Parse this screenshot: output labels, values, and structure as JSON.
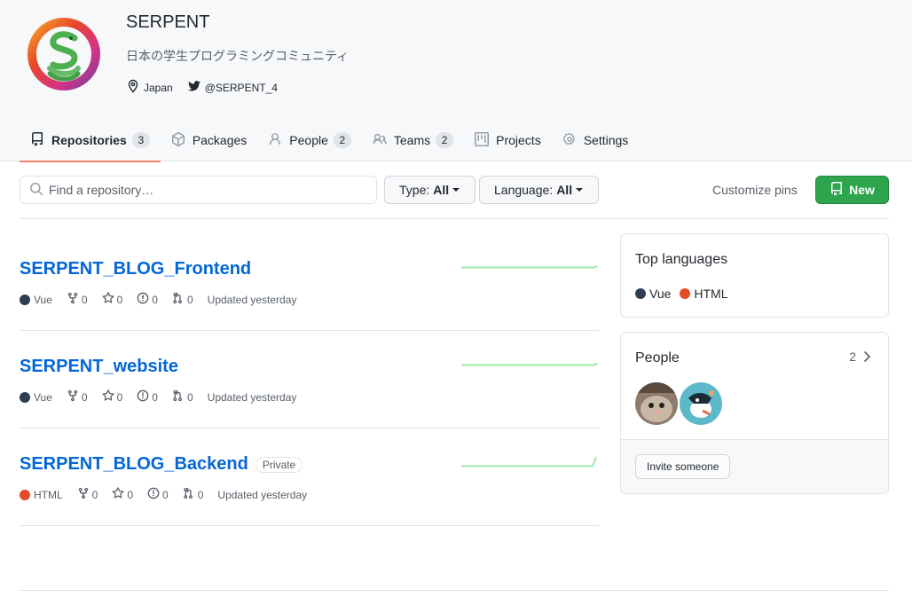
{
  "org": {
    "name": "SERPENT",
    "description": "日本の学生プログラミングコミュニティ",
    "location": "Japan",
    "twitter": "@SERPENT_4"
  },
  "tabs": [
    {
      "label": "Repositories",
      "count": "3",
      "active": true
    },
    {
      "label": "Packages"
    },
    {
      "label": "People",
      "count": "2"
    },
    {
      "label": "Teams",
      "count": "2"
    },
    {
      "label": "Projects"
    },
    {
      "label": "Settings"
    }
  ],
  "toolbar": {
    "search_placeholder": "Find a repository…",
    "type_label": "Type:",
    "type_value": "All",
    "language_label": "Language:",
    "language_value": "All",
    "customize_pins": "Customize pins",
    "new_label": "New"
  },
  "repos": [
    {
      "name": "SERPENT_BLOG_Frontend",
      "language": "Vue",
      "language_color": "#2c3e50",
      "forks": "0",
      "stars": "0",
      "issues": "0",
      "pulls": "0",
      "updated": "Updated yesterday"
    },
    {
      "name": "SERPENT_website",
      "language": "Vue",
      "language_color": "#2c3e50",
      "forks": "0",
      "stars": "0",
      "issues": "0",
      "pulls": "0",
      "updated": "Updated yesterday"
    },
    {
      "name": "SERPENT_BLOG_Backend",
      "private_label": "Private",
      "language": "HTML",
      "language_color": "#e34c26",
      "forks": "0",
      "stars": "0",
      "issues": "0",
      "pulls": "0",
      "updated": "Updated yesterday"
    }
  ],
  "top_languages": {
    "title": "Top languages",
    "items": [
      {
        "name": "Vue",
        "color": "#2c3e50"
      },
      {
        "name": "HTML",
        "color": "#e34c26"
      }
    ]
  },
  "people": {
    "title": "People",
    "count": "2",
    "invite_label": "Invite someone"
  },
  "colors": {
    "link": "#0366d6",
    "new_button": "#2ea44f",
    "active_tab_underline": "#f9826c",
    "sparkline": "#9be9a8"
  }
}
